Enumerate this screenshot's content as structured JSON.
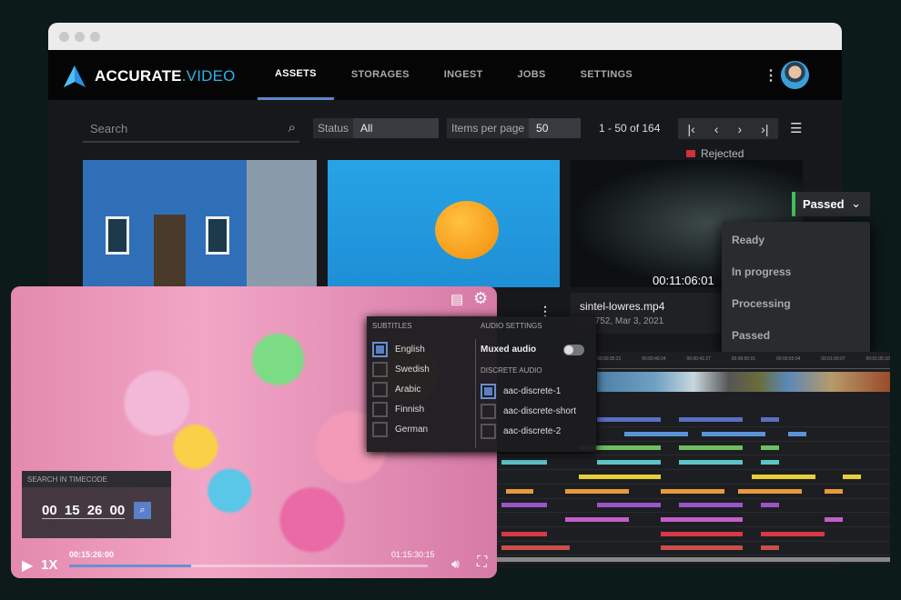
{
  "app": {
    "logo_main": "ACCURATE",
    "logo_accent": ".VIDEO"
  },
  "nav": [
    "ASSETS",
    "STORAGES",
    "INGEST",
    "JOBS",
    "SETTINGS"
  ],
  "toolbar": {
    "search_placeholder": "Search",
    "status_label": "Status",
    "status_value": "All",
    "ipp_label": "Items per page",
    "ipp_value": "50",
    "range": "1 - 50 of 164"
  },
  "cards": {
    "c3_timecode": "00:11:06:01",
    "c3_badge": "Rejected",
    "c3_title": "sintel-lowres.mp4",
    "c3_meta": "174752, Mar 3, 2021"
  },
  "status_dropdown": {
    "selected": "Passed",
    "options": [
      "Ready",
      "In progress",
      "Processing",
      "Passed"
    ],
    "accent": "#3fbf5a"
  },
  "player": {
    "search_title": "SEARCH IN TIMECODE",
    "search_value": "00 15 26 00",
    "speed": "1X",
    "current": "00:15:26:00",
    "duration": "01:15:30:15",
    "progress": 0.34
  },
  "settings": {
    "subtitles_title": "SUBTITLES",
    "subtitles": [
      {
        "label": "English",
        "checked": true
      },
      {
        "label": "Swedish",
        "checked": false
      },
      {
        "label": "Arabic",
        "checked": false
      },
      {
        "label": "Finnish",
        "checked": false
      },
      {
        "label": "German",
        "checked": false
      }
    ],
    "audio_title": "AUDIO SETTINGS",
    "muxed_label": "Muxed audio",
    "muxed_on": false,
    "discrete_title": "DISCRETE AUDIO",
    "discrete": [
      {
        "label": "aac-discrete-1",
        "checked": true
      },
      {
        "label": "aac-discrete-short",
        "checked": false
      },
      {
        "label": "aac-discrete-2",
        "checked": false
      }
    ]
  },
  "timeline": {
    "ticks": [
      "00:00:35:21",
      "00:00:40:24",
      "00:00:41:27",
      "00:00:50:01",
      "00:00:55:04",
      "00:01:00:07",
      "00:01:05:10"
    ],
    "track_colors": [
      "#5a6fc0",
      "#5b93d8",
      "#6cc060",
      "#5cc4c8",
      "#e8cf3a",
      "#e89a3a",
      "#9a55c8",
      "#c060c8",
      "#d83848",
      "#c8504a"
    ]
  }
}
